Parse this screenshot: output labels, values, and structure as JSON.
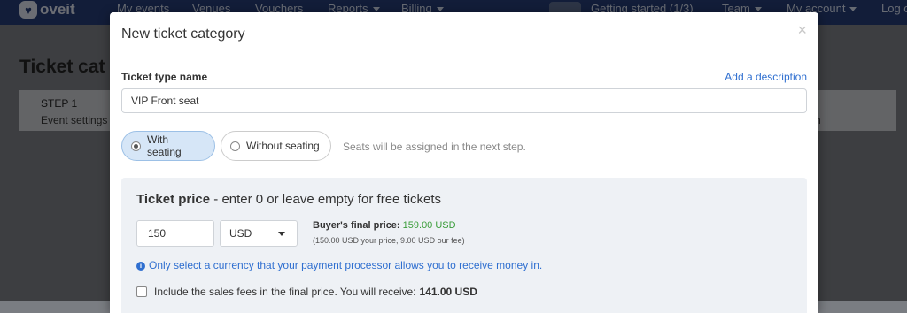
{
  "navbar": {
    "logo": "oveit",
    "items": [
      "My events",
      "Venues",
      "Vouchers",
      "Reports",
      "Billing"
    ],
    "right_items": [
      "Getting started (1/3)",
      "Team",
      "My account",
      "Log o"
    ]
  },
  "background": {
    "page_title": "Ticket cat",
    "step_label": "STEP 1",
    "step_sub": "Event settings",
    "right_fragment": "n"
  },
  "modal": {
    "title": "New ticket category",
    "close_glyph": "×",
    "ticket_type_label": "Ticket type name",
    "add_description": "Add a description",
    "ticket_name_value": "VIP Front seat",
    "seating": {
      "with_label": "With seating",
      "without_label": "Without seating",
      "selected": "with",
      "hint": "Seats will be assigned in the next step."
    },
    "price": {
      "title_bold": "Ticket price",
      "title_rest": " - enter 0 or leave empty for free tickets",
      "value": "150",
      "currency": "USD",
      "final_label": "Buyer's final price:",
      "final_value": "159.00 USD",
      "final_sub": "(150.00 USD your price, 9.00 USD our fee)",
      "info": "Only select a currency that your payment processor allows you to receive money in.",
      "fee_text": "Include the sales fees in the final price. You will receive:",
      "fee_value": "141.00 USD"
    }
  },
  "colors": {
    "navbar": "#243a73",
    "link": "#2f6fd0",
    "final_price": "#3a9d3a",
    "selected_seat_bg": "#d6e6f7"
  }
}
